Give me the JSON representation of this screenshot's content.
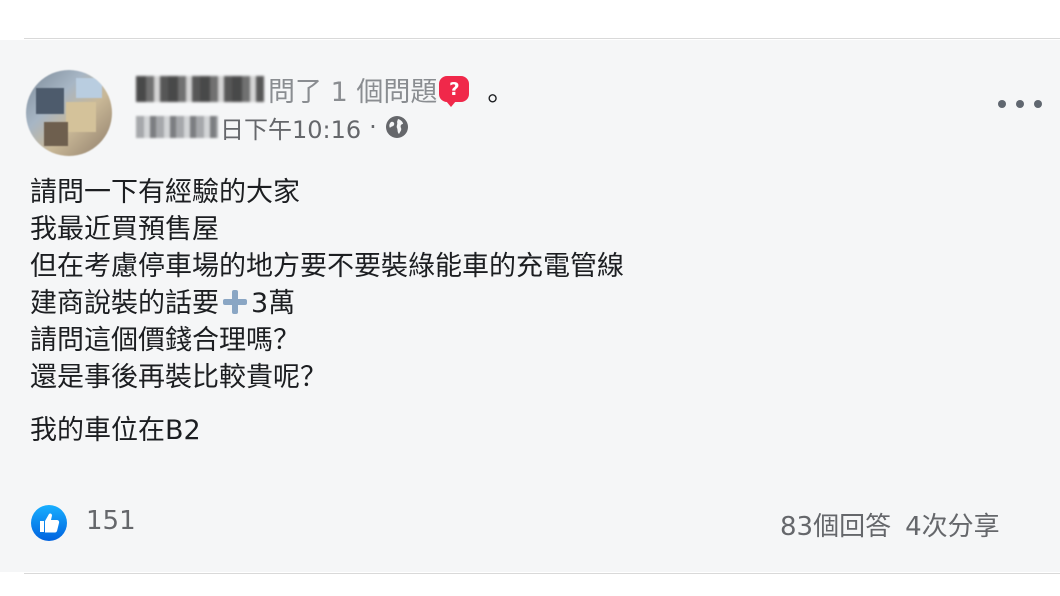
{
  "post": {
    "author_suffix": "問了 1 個問題",
    "question_badge": "?",
    "trailing_mark": "。",
    "timestamp": "日下午10:16",
    "separator": "·",
    "privacy_icon": "globe-icon",
    "more_icon": "more-options-icon"
  },
  "body": {
    "lines": [
      "請問一下有經驗的大家",
      "我最近買預售屋",
      "但在考慮停車場的地方要不要裝綠能車的充電管線"
    ],
    "line4_before": "建商說裝的話要",
    "line4_after": "3萬",
    "line5": "請問這個價錢合理嗎？",
    "line6": "還是事後再裝比較貴呢？",
    "line7": "我的車位在B2"
  },
  "footer": {
    "like_icon": "like-icon",
    "like_count": "151",
    "comments": "83個回答",
    "shares": "4次分享"
  },
  "colors": {
    "card_background": "#f5f6f7",
    "text_primary": "#1c1e21",
    "text_secondary": "#65676b",
    "like_blue": "#1877f2",
    "badge_red": "#f0284a"
  }
}
